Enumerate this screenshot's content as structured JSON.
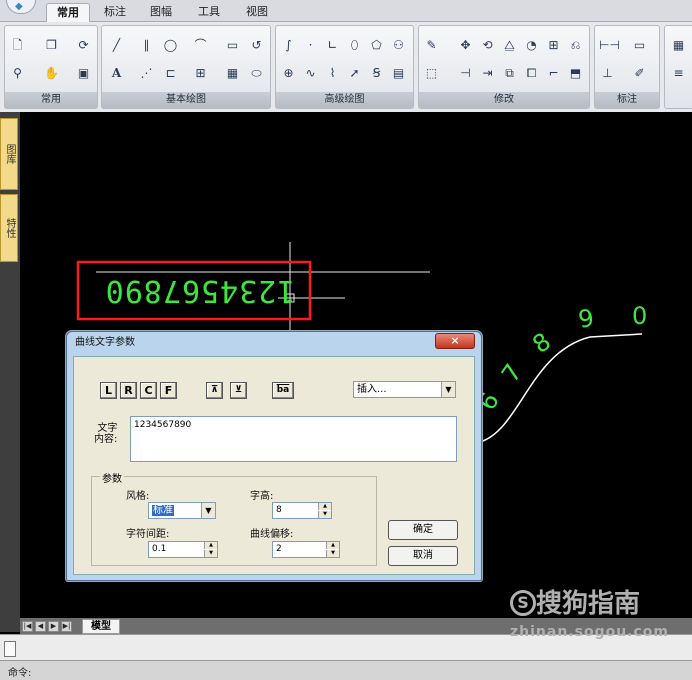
{
  "menu": {
    "tabs": [
      "常用",
      "标注",
      "图幅",
      "工具",
      "视图"
    ],
    "active": "常用"
  },
  "ribbon": {
    "groups": [
      "常用",
      "基本绘图",
      "高级绘图",
      "修改",
      "标注"
    ]
  },
  "side_tabs": [
    "图库",
    "特性"
  ],
  "canvas": {
    "mirrored_text": "1234567890",
    "curve_labels": [
      "6",
      "7",
      "8",
      "9",
      "0"
    ]
  },
  "dialog": {
    "title": "曲线文字参数",
    "close": "×",
    "align_buttons": [
      "L",
      "R",
      "C",
      "F"
    ],
    "icon_button_label": "ba",
    "insert_select": "插入...",
    "content_label": "文字\n内容:",
    "content_value": "1234567890",
    "params_legend": "参数",
    "style_label": "风格:",
    "style_value": "标准",
    "height_label": "字高:",
    "height_value": "8",
    "spacing_label": "字符间距:",
    "spacing_value": "0.1",
    "offset_label": "曲线偏移:",
    "offset_value": "2",
    "ok": "确定",
    "cancel": "取消"
  },
  "bottom": {
    "model_tab": "模型",
    "nav": [
      "|◀",
      "◀",
      "▶",
      "▶|"
    ]
  },
  "status": {
    "command_prompt": "命令:"
  },
  "watermark": {
    "brand": "搜狗指南",
    "url": "zhinan.sogou.com"
  },
  "colors": {
    "text_green": "#3ee63e",
    "highlight_red": "#ff1a1a",
    "dialog_border": "#4d6f93"
  }
}
